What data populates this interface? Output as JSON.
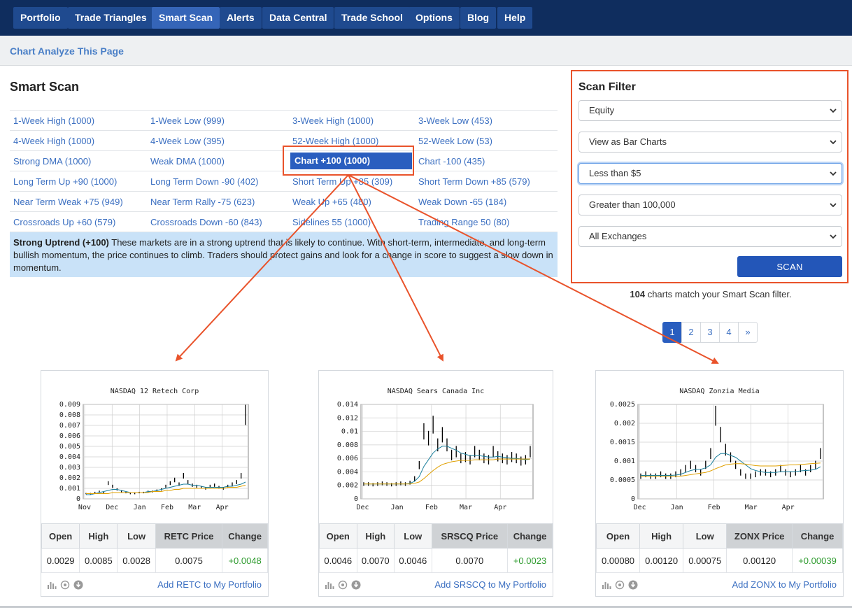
{
  "nav": {
    "items": [
      "Portfolio",
      "Trade Triangles",
      "Smart Scan",
      "Alerts",
      "Data Central",
      "Trade School",
      "Options",
      "Blog",
      "Help"
    ],
    "active": "Smart Scan"
  },
  "subbar": {
    "link": "Chart Analyze This Page"
  },
  "page_title": "Smart Scan",
  "scan_grid": [
    [
      "1-Week High (1000)",
      "1-Week Low (999)",
      "3-Week High (1000)",
      "3-Week Low (453)"
    ],
    [
      "4-Week High (1000)",
      "4-Week Low (395)",
      "52-Week High (1000)",
      "52-Week Low (53)"
    ],
    [
      "Strong DMA (1000)",
      "Weak DMA (1000)",
      "Chart +100 (1000)",
      "Chart -100 (435)"
    ],
    [
      "Long Term Up +90 (1000)",
      "Long Term Down -90 (402)",
      "Short Term Up +85 (309)",
      "Short Term Down +85 (579)"
    ],
    [
      "Near Term Weak +75 (949)",
      "Near Term Rally -75 (623)",
      "Weak Up +65 (480)",
      "Weak Down -65 (184)"
    ],
    [
      "Crossroads Up +60 (579)",
      "Crossroads Down -60 (843)",
      "Sidelines 55 (1000)",
      "Trading Range 50 (80)"
    ]
  ],
  "selected_scan": "Chart +100 (1000)",
  "description": {
    "bold": "Strong Uptrend (+100)",
    "text": " These markets are in a strong uptrend that is likely to continue. With short-term, intermediate, and long-term bullish momentum, the price continues to climb. Traders should protect gains and look for a change in score to suggest a slow down in momentum."
  },
  "filter": {
    "title": "Scan Filter",
    "selects": [
      "Equity",
      "View as Bar Charts",
      "Less than $5",
      "Greater than 100,000",
      "All Exchanges"
    ],
    "scan_button": "SCAN",
    "match_count": "104",
    "match_text": " charts match your Smart Scan filter."
  },
  "pager": [
    "1",
    "2",
    "3",
    "4",
    "»"
  ],
  "colors": {
    "nav_bg": "#0f2d5e",
    "nav_btn": "#1f4a8f",
    "link": "#3b6fc1",
    "highlight": "#e9532b",
    "positive": "#2e9b2e"
  },
  "cards": [
    {
      "quote_headers": [
        "Open",
        "High",
        "Low",
        "RETC Price",
        "Change"
      ],
      "quote_values": [
        "0.0029",
        "0.0085",
        "0.0028",
        "0.0075",
        "+0.0048"
      ],
      "add_link": "Add RETC to My Portfolio",
      "chart_data": {
        "type": "bar",
        "title": "NASDAQ 12 Retech Corp",
        "x_ticks": [
          "Nov",
          "Dec",
          "Jan",
          "Feb",
          "Mar",
          "Apr"
        ],
        "y_ticks": [
          "0",
          "0.001",
          "0.002",
          "0.003",
          "0.004",
          "0.005",
          "0.006",
          "0.007",
          "0.008",
          "0.009"
        ],
        "ylim": [
          0,
          0.009
        ],
        "grid": true,
        "series": [
          {
            "values": [
              0.0005,
              0.0005,
              0.0006,
              0.0007,
              0.0006,
              0.0015,
              0.0012,
              0.0009,
              0.0007,
              0.0006,
              0.0005,
              0.0005,
              0.0006,
              0.0006,
              0.0007,
              0.0007,
              0.0008,
              0.0009,
              0.0012,
              0.0015,
              0.0018,
              0.0014,
              0.0022,
              0.0016,
              0.0013,
              0.0012,
              0.0011,
              0.001,
              0.0012,
              0.0013,
              0.0011,
              0.001,
              0.0012,
              0.0014,
              0.0016,
              0.0022,
              0.008
            ]
          },
          {
            "values": [
              0.0004,
              0.0004,
              0.0005,
              0.0006,
              0.0007,
              0.0008,
              0.0009,
              0.0009,
              0.0008,
              0.0007,
              0.0006,
              0.0006,
              0.0006,
              0.0006,
              0.0007,
              0.0007,
              0.0008,
              0.0009,
              0.001,
              0.0011,
              0.0012,
              0.0013,
              0.0014,
              0.0014,
              0.0013,
              0.0013,
              0.0012,
              0.0011,
              0.0011,
              0.0011,
              0.0011,
              0.0011,
              0.0012,
              0.0012,
              0.0013,
              0.0014,
              0.0016
            ]
          },
          {
            "values": [
              0.0005,
              0.0005,
              0.0005,
              0.0005,
              0.0005,
              0.0005,
              0.0006,
              0.0006,
              0.0006,
              0.0006,
              0.0006,
              0.0006,
              0.0006,
              0.0006,
              0.0006,
              0.0007,
              0.0007,
              0.0007,
              0.0008,
              0.0008,
              0.0009,
              0.0009,
              0.001,
              0.001,
              0.001,
              0.001,
              0.001,
              0.001,
              0.001,
              0.001,
              0.001,
              0.001,
              0.0011,
              0.0011,
              0.0011,
              0.0012,
              0.0013
            ]
          }
        ]
      }
    },
    {
      "quote_headers": [
        "Open",
        "High",
        "Low",
        "SRSCQ Price",
        "Change"
      ],
      "quote_values": [
        "0.0046",
        "0.0070",
        "0.0046",
        "0.0070",
        "+0.0023"
      ],
      "add_link": "Add SRSCQ to My Portfolio",
      "chart_data": {
        "type": "bar",
        "title": "NASDAQ Sears Canada Inc",
        "x_ticks": [
          "Dec",
          "Jan",
          "Feb",
          "Mar",
          "Apr"
        ],
        "y_ticks": [
          "0",
          "0.002",
          "0.004",
          "0.006",
          "0.008",
          "0.01",
          "0.012",
          "0.014"
        ],
        "ylim": [
          0,
          0.014
        ],
        "grid": true,
        "series": [
          {
            "values": [
              0.0022,
              0.0022,
              0.0021,
              0.0022,
              0.0023,
              0.0022,
              0.0021,
              0.0022,
              0.0023,
              0.0022,
              0.0024,
              0.003,
              0.005,
              0.01,
              0.009,
              0.011,
              0.008,
              0.0095,
              0.008,
              0.0065,
              0.007,
              0.006,
              0.0062,
              0.0058,
              0.007,
              0.0065,
              0.006,
              0.0058,
              0.007,
              0.0063,
              0.006,
              0.0058,
              0.0062,
              0.006,
              0.0056,
              0.0058,
              0.007
            ]
          },
          {
            "values": [
              0.0022,
              0.0022,
              0.0022,
              0.0022,
              0.0022,
              0.0022,
              0.0022,
              0.0022,
              0.0022,
              0.0022,
              0.0023,
              0.0026,
              0.0033,
              0.0048,
              0.0058,
              0.0068,
              0.0074,
              0.0078,
              0.0078,
              0.0075,
              0.0072,
              0.0068,
              0.0066,
              0.0064,
              0.0064,
              0.0064,
              0.0063,
              0.0062,
              0.0062,
              0.0063,
              0.0062,
              0.0061,
              0.006,
              0.006,
              0.0059,
              0.0058,
              0.0059
            ]
          },
          {
            "values": [
              0.0022,
              0.0022,
              0.0022,
              0.0022,
              0.0022,
              0.0022,
              0.0022,
              0.0022,
              0.0022,
              0.0022,
              0.0022,
              0.0023,
              0.0025,
              0.003,
              0.0036,
              0.0042,
              0.0047,
              0.0051,
              0.0053,
              0.0055,
              0.0056,
              0.0057,
              0.0057,
              0.0057,
              0.0058,
              0.0058,
              0.0058,
              0.0058,
              0.0058,
              0.0059,
              0.0059,
              0.0059,
              0.0059,
              0.0059,
              0.0059,
              0.0059,
              0.0059
            ]
          }
        ]
      }
    },
    {
      "quote_headers": [
        "Open",
        "High",
        "Low",
        "ZONX Price",
        "Change"
      ],
      "quote_values": [
        "0.00080",
        "0.00120",
        "0.00075",
        "0.00120",
        "+0.00039"
      ],
      "add_link": "Add ZONX to My Portfolio",
      "chart_data": {
        "type": "bar",
        "title": "NASDAQ Zonzia Media",
        "x_ticks": [
          "Dec",
          "Jan",
          "Feb",
          "Mar",
          "Apr"
        ],
        "y_ticks": [
          "0",
          "0.0005",
          "0.001",
          "0.0015",
          "0.002",
          "0.0025"
        ],
        "ylim": [
          0,
          0.0025
        ],
        "grid": true,
        "series": [
          {
            "values": [
              0.0006,
              0.00065,
              0.0006,
              0.0006,
              0.00065,
              0.0006,
              0.0006,
              0.00065,
              0.0007,
              0.0008,
              0.0009,
              0.0008,
              0.0007,
              0.0009,
              0.0012,
              0.0022,
              0.0017,
              0.0013,
              0.0011,
              0.0009,
              0.0007,
              0.0006,
              0.0006,
              0.00065,
              0.0007,
              0.0007,
              0.00065,
              0.0007,
              0.0008,
              0.0007,
              0.00065,
              0.0007,
              0.0008,
              0.0007,
              0.0008,
              0.0009,
              0.0012
            ]
          },
          {
            "values": [
              0.00062,
              0.00062,
              0.00062,
              0.00062,
              0.00062,
              0.00062,
              0.00062,
              0.00063,
              0.00065,
              0.0007,
              0.00075,
              0.00078,
              0.00078,
              0.00082,
              0.0009,
              0.0011,
              0.0012,
              0.0012,
              0.00115,
              0.0011,
              0.001,
              0.0009,
              0.0008,
              0.00075,
              0.00072,
              0.0007,
              0.0007,
              0.0007,
              0.00072,
              0.00072,
              0.00072,
              0.00072,
              0.00074,
              0.00075,
              0.00076,
              0.00078,
              0.00085
            ]
          },
          {
            "values": [
              0.0006,
              0.0006,
              0.0006,
              0.0006,
              0.0006,
              0.0006,
              0.0006,
              0.0006,
              0.0006,
              0.00062,
              0.00064,
              0.00066,
              0.00068,
              0.0007,
              0.00074,
              0.0008,
              0.00085,
              0.0009,
              0.00092,
              0.00093,
              0.00093,
              0.00092,
              0.0009,
              0.00088,
              0.00087,
              0.00087,
              0.00087,
              0.00087,
              0.00088,
              0.00089,
              0.0009,
              0.0009,
              0.00091,
              0.00092,
              0.00093,
              0.00094,
              0.00095
            ]
          }
        ]
      }
    }
  ]
}
